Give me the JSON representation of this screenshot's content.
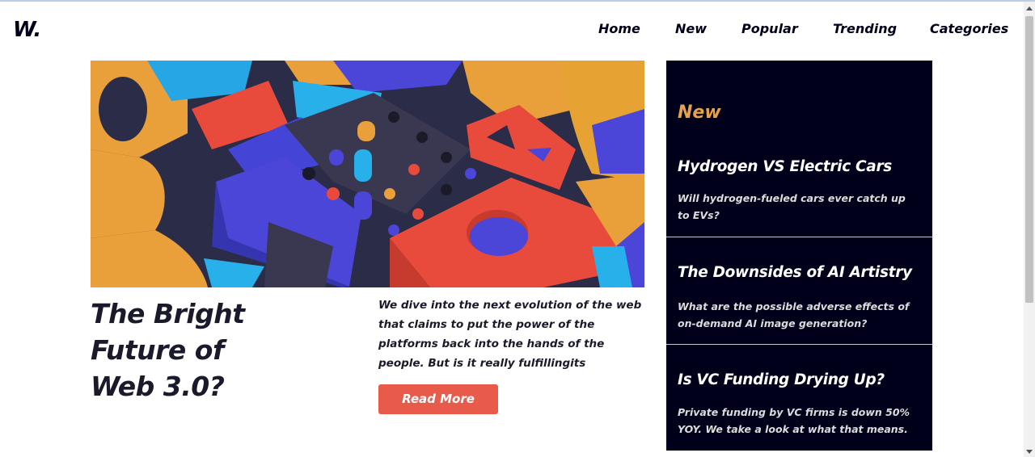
{
  "header": {
    "logo": "W.",
    "nav": [
      {
        "label": "Home"
      },
      {
        "label": "New"
      },
      {
        "label": "Popular"
      },
      {
        "label": "Trending"
      },
      {
        "label": "Categories"
      }
    ]
  },
  "hero": {
    "title_lines": [
      "The Bright",
      "Future of",
      "Web 3.0?"
    ],
    "description": "We dive into the next evolution of the web that claims to put the power of the platforms back into the hands of the people. But is it really fulfillingits",
    "read_more": "Read More"
  },
  "sidebar": {
    "heading": "New",
    "items": [
      {
        "title": "Hydrogen VS Electric Cars",
        "description": "Will hydrogen-fueled cars ever catch up to EVs?"
      },
      {
        "title": "The Downsides of AI Artistry",
        "description": "What are the possible adverse effects of on-demand AI image generation?"
      },
      {
        "title": "Is VC Funding Drying Up?",
        "description": "Private funding by VC firms is down 50% YOY. We take a look at what that means."
      }
    ]
  },
  "colors": {
    "accent_red": "#e85a4a",
    "sidebar_bg": "#00001a",
    "sidebar_heading": "#e6a14a",
    "text_dark": "#00001a"
  }
}
